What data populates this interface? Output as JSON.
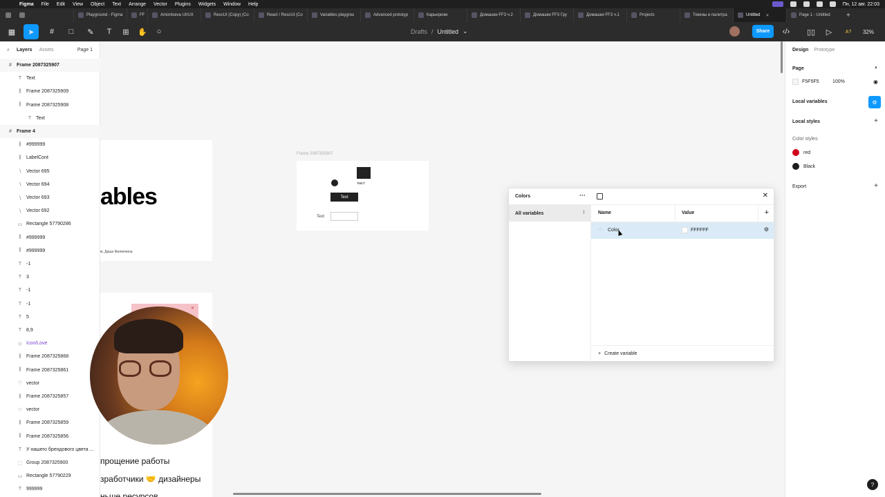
{
  "menubar": {
    "items": [
      "Figma",
      "File",
      "Edit",
      "View",
      "Object",
      "Text",
      "Arrange",
      "Vector",
      "Plugins",
      "Widgets",
      "Window",
      "Help"
    ],
    "clock": "Пн, 12 авг. 22:03"
  },
  "tabs": [
    {
      "label": "Playground - Figma",
      "active": false
    },
    {
      "label": "FF",
      "active": false
    },
    {
      "label": "Antontseva UI/UX",
      "active": false
    },
    {
      "label": "RescUI (Copy) (Co",
      "active": false
    },
    {
      "label": "React / RescUI (Co",
      "active": false
    },
    {
      "label": "Variables playgrou",
      "active": false
    },
    {
      "label": "Advanced prototyp",
      "active": false
    },
    {
      "label": "Карьеризм",
      "active": false
    },
    {
      "label": "Домашки FF3 ч.2",
      "active": false
    },
    {
      "label": "Домашки FF3 Гру",
      "active": false
    },
    {
      "label": "Домашки FF3 ч.1",
      "active": false
    },
    {
      "label": "Projects",
      "active": false
    },
    {
      "label": "Токены и палитра",
      "active": false
    },
    {
      "label": "Untitled",
      "active": true
    },
    {
      "label": "Page 1 - Untitled",
      "active": false
    }
  ],
  "toolbar": {
    "breadcrumb_parent": "Drafts",
    "breadcrumb_sep": "/",
    "file_name": "Untitled",
    "share_label": "Share",
    "zoom": "32%",
    "font_hint": "A?"
  },
  "left_panel": {
    "tab_layers": "Layers",
    "tab_assets": "Assets",
    "page_label": "Page 1",
    "layers": [
      {
        "label": "Frame 2087325907",
        "icon": "frame-icon",
        "indent": 0,
        "bold": true
      },
      {
        "label": "Text",
        "icon": "text-icon",
        "indent": 1
      },
      {
        "label": "Frame 2087325909",
        "icon": "autolayout-icon",
        "indent": 1
      },
      {
        "label": "Frame 2087325908",
        "icon": "autolayout-icon",
        "indent": 1
      },
      {
        "label": "Text",
        "icon": "text-icon",
        "indent": 2
      },
      {
        "label": "Frame 4",
        "icon": "frame-icon",
        "indent": 0,
        "bold": true
      },
      {
        "label": "#999999",
        "icon": "autolayout-icon",
        "indent": 1
      },
      {
        "label": "LabelCont",
        "icon": "autolayout-icon",
        "indent": 1
      },
      {
        "label": "Vector 695",
        "icon": "vector-icon",
        "indent": 1
      },
      {
        "label": "Vector 694",
        "icon": "vector-icon",
        "indent": 1
      },
      {
        "label": "Vector 693",
        "icon": "vector-icon",
        "indent": 1
      },
      {
        "label": "Vector 692",
        "icon": "vector-icon",
        "indent": 1
      },
      {
        "label": "Rectangle 57790286",
        "icon": "rect-icon",
        "indent": 1
      },
      {
        "label": "#999999",
        "icon": "autolayout-icon",
        "indent": 1
      },
      {
        "label": "#999999",
        "icon": "autolayout-icon",
        "indent": 1
      },
      {
        "label": "-1",
        "icon": "text-icon",
        "indent": 1
      },
      {
        "label": "3",
        "icon": "text-icon",
        "indent": 1
      },
      {
        "label": "-1",
        "icon": "text-icon",
        "indent": 1
      },
      {
        "label": "-1",
        "icon": "text-icon",
        "indent": 1
      },
      {
        "label": "5",
        "icon": "text-icon",
        "indent": 1
      },
      {
        "label": "8,9",
        "icon": "text-icon",
        "indent": 1
      },
      {
        "label": "Icon/Love",
        "icon": "component-icon",
        "indent": 1,
        "purple": true
      },
      {
        "label": "Frame 2087325868",
        "icon": "autolayout-icon",
        "indent": 1
      },
      {
        "label": "Frame 2087325861",
        "icon": "autolayout-icon",
        "indent": 1
      },
      {
        "label": "vector",
        "icon": "heart-icon",
        "indent": 1
      },
      {
        "label": "Frame 2087325857",
        "icon": "autolayout-icon",
        "indent": 1
      },
      {
        "label": "vector",
        "icon": "heart-icon",
        "indent": 1
      },
      {
        "label": "Frame 2087325859",
        "icon": "autolayout-icon",
        "indent": 1
      },
      {
        "label": "Frame 2087325856",
        "icon": "autolayout-icon",
        "indent": 1
      },
      {
        "label": "У нашего брендового цвета ...",
        "icon": "text-icon",
        "indent": 1
      },
      {
        "label": "Group 2087325900",
        "icon": "group-icon",
        "indent": 1
      },
      {
        "label": "Rectangle 57790229",
        "icon": "rect-icon",
        "indent": 1
      },
      {
        "label": "999999",
        "icon": "text-icon",
        "indent": 1
      }
    ]
  },
  "canvas": {
    "big_text": "ables",
    "credit": "м, Даша Филипчина",
    "frame_label": "Frame 2087325907",
    "tekst": "текст",
    "button_text": "Text",
    "input_label": "Text",
    "bottom_lines": [
      "прощение работы",
      "зработчики 🤝 дизайнеры",
      "ньше ресурсов"
    ]
  },
  "variables_modal": {
    "collection": "Colors",
    "sidebar_item": "All variables",
    "sidebar_count": "1",
    "col_name": "Name",
    "col_value": "Value",
    "variable_name": "Color",
    "variable_value": "FFFFFF",
    "create_label": "Create variable"
  },
  "right_panel": {
    "tab_design": "Design",
    "tab_prototype": "Prototype",
    "page_heading": "Page",
    "page_color": "F5F5F5",
    "page_opacity": "100%",
    "local_variables": "Local variables",
    "local_styles": "Local styles",
    "color_styles": "Color styles",
    "styles": [
      {
        "name": "red",
        "color": "#d0021b"
      },
      {
        "name": "Black",
        "color": "#1e1e1e"
      }
    ],
    "export": "Export",
    "help": "?"
  },
  "colors": {
    "accent": "#0d99ff",
    "selected_row": "#daebf7"
  }
}
